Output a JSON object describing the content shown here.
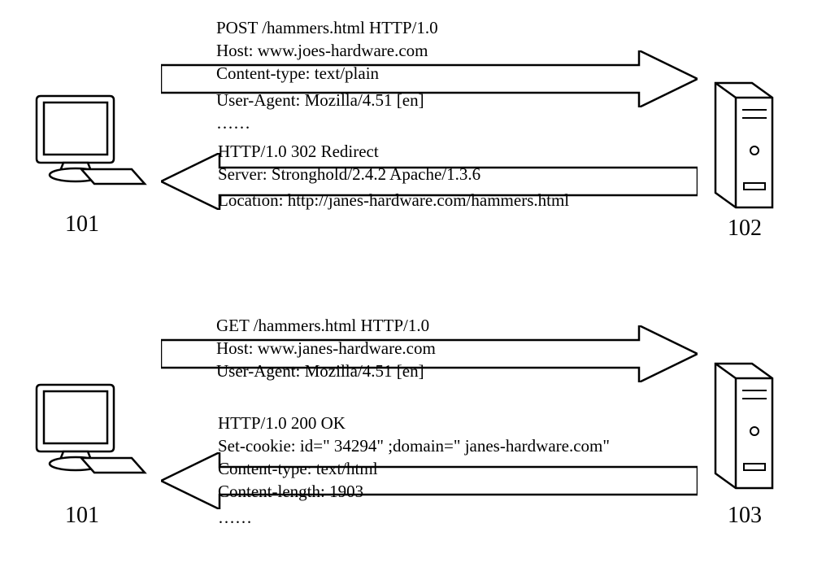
{
  "labels": {
    "client_top": "101",
    "server_top": "102",
    "client_bottom": "101",
    "server_bottom": "103"
  },
  "req1": {
    "l1": "POST /hammers.html HTTP/1.0",
    "l2": "Host: www.joes-hardware.com",
    "l3": "Content-type: text/plain",
    "l4": "User-Agent: Mozilla/4.51 [en]",
    "l5": "……"
  },
  "resp1": {
    "l1": "HTTP/1.0 302 Redirect",
    "l2": "Server: Stronghold/2.4.2 Apache/1.3.6",
    "l3": "Location: http://janes-hardware.com/hammers.html"
  },
  "req2": {
    "l1": "GET /hammers.html HTTP/1.0",
    "l2": "Host: www.janes-hardware.com",
    "l3": "User-Agent: Mozilla/4.51 [en]"
  },
  "resp2": {
    "l1": "HTTP/1.0 200 OK",
    "l2": "Set-cookie: id=\" 34294\" ;domain=\" janes-hardware.com\"",
    "l3": "Content-type: text/html",
    "l4": "Content-length: 1903",
    "l5": "……"
  }
}
